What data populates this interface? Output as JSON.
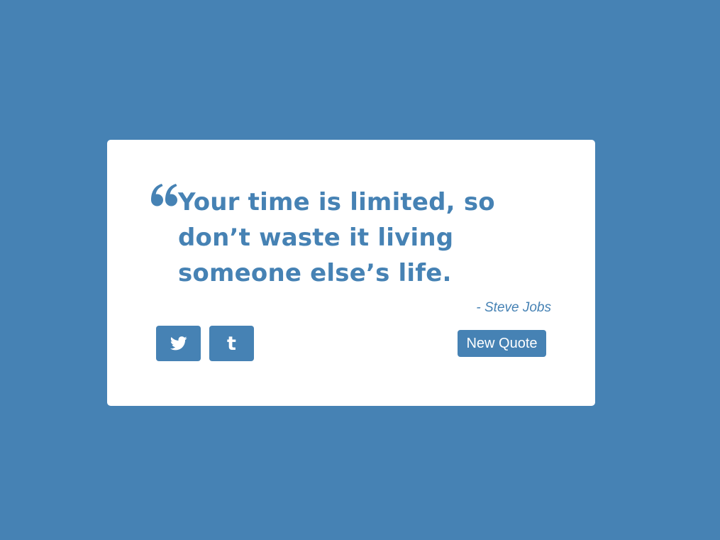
{
  "theme": {
    "background_color": "#4682b4",
    "card_color": "#ffffff",
    "accent_color": "#4682b4"
  },
  "quote": {
    "icon": "quote-left-icon",
    "text": "Your time is limited, so don’t waste it living someone else’s life.",
    "author": "- Steve Jobs"
  },
  "actions": {
    "tweet_icon": "twitter-icon",
    "tumblr_icon": "tumblr-icon",
    "tumblr_glyph": "t",
    "new_quote_label": "New Quote"
  }
}
